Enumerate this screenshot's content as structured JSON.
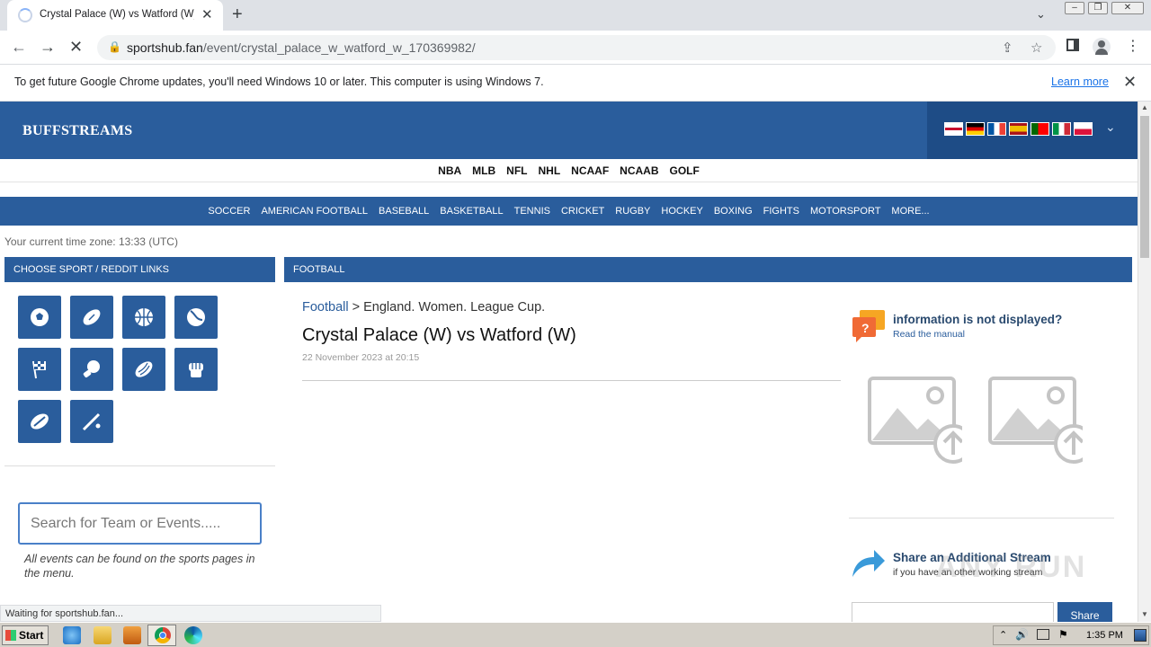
{
  "browser": {
    "tab_title": "Crystal Palace (W) vs Watford (W)...",
    "tab_close": "✕",
    "new_tab": "+",
    "url_domain": "sportshub.fan",
    "url_path": "/event/crystal_palace_w_watford_w_170369982/"
  },
  "infobar": {
    "message": "To get future Google Chrome updates, you'll need Windows 10 or later. This computer is using Windows 7.",
    "learn_more": "Learn more"
  },
  "site": {
    "logo": "BUFFSTREAMS",
    "leagues": [
      "NBA",
      "MLB",
      "NFL",
      "NHL",
      "NCAAF",
      "NCAAB",
      "GOLF"
    ],
    "sports_menu": [
      "SOCCER",
      "AMERICAN FOOTBALL",
      "BASEBALL",
      "BASKETBALL",
      "TENNIS",
      "CRICKET",
      "RUGBY",
      "HOCKEY",
      "BOXING",
      "FIGHTS",
      "MOTORSPORT",
      "MORE..."
    ],
    "timezone": "Your current time zone: 13:33 (UTC)"
  },
  "left_panel": {
    "heading": "CHOOSE SPORT / REDDIT LINKS",
    "sport_icons": [
      "soccer-icon",
      "american-football-icon",
      "basketball-icon",
      "tennis-icon",
      "motorsport-icon",
      "boxing-icon",
      "rugby-icon",
      "fighting-icon",
      "hockey-icon",
      "cricket-icon"
    ],
    "search_placeholder": "Search for Team or Events.....",
    "search_note": "All events can be found on the sports pages in the menu."
  },
  "main_panel": {
    "heading": "FOOTBALL",
    "crumb_link": "Football",
    "crumb_rest": " > England. Women. League Cup.",
    "event_title": "Crystal Palace (W) vs Watford (W)",
    "event_date": "22 November 2023 at 20:15",
    "notice_title": "information is not displayed?",
    "notice_link": "Read the manual",
    "share_title": "Share an Additional Stream",
    "share_sub": "if you have an other working stream",
    "share_button": "Share"
  },
  "status": "Waiting for sportshub.fan...",
  "watermark": "ANY RUN",
  "taskbar": {
    "start": "Start",
    "clock": "1:35 PM"
  }
}
